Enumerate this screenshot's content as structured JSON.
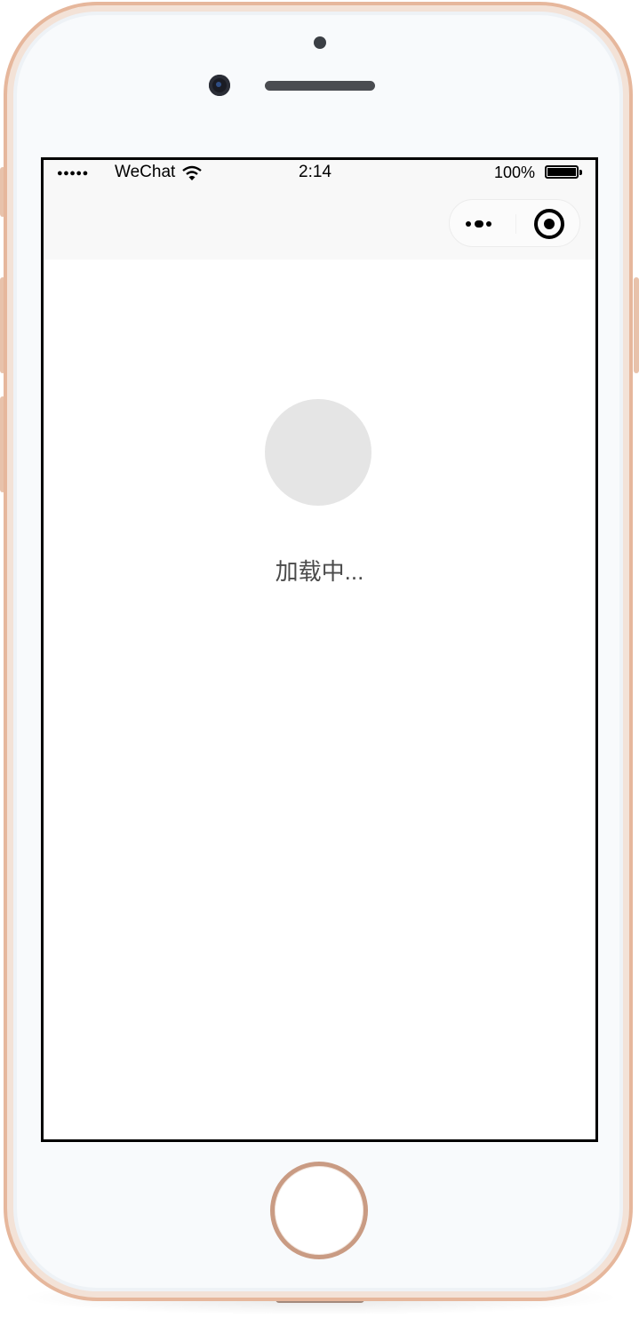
{
  "status_bar": {
    "signal": "●●●●●",
    "carrier": "WeChat",
    "wifi_icon": "wifi-icon",
    "time": "2:14",
    "battery_percent": "100%",
    "battery_icon": "battery-icon",
    "battery_level": 1.0
  },
  "nav_bar": {
    "more_icon": "more-dots-icon",
    "close_icon": "target-circle-icon"
  },
  "content": {
    "loading_text": "加载中..."
  },
  "colors": {
    "phone_frame": "#e6b79c",
    "nav_background": "#f8f8f8",
    "placeholder_circle": "#e5e5e5",
    "text": "#4a4a4a"
  }
}
